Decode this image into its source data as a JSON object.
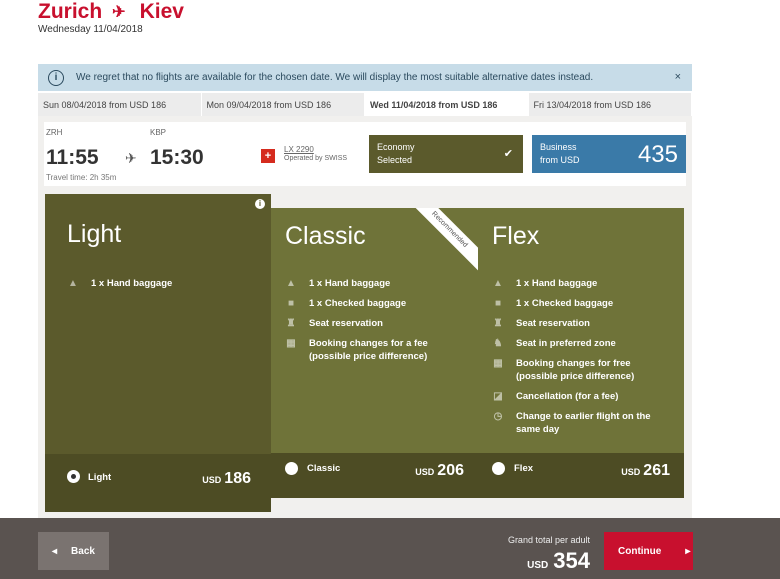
{
  "header": {
    "origin": "Zurich",
    "destination": "Kiev",
    "date": "Wednesday 11/04/2018"
  },
  "notice": {
    "text": "We regret that no flights are available for the chosen date. We will display the most suitable alternative dates instead.",
    "close": "×"
  },
  "dates": [
    {
      "label": "Sun 08/04/2018 from USD 186"
    },
    {
      "label": "Mon 09/04/2018 from USD 186"
    },
    {
      "label": "Wed 11/04/2018 from USD 186"
    },
    {
      "label": "Fri 13/04/2018 from USD 186"
    }
  ],
  "flight": {
    "dep_code": "ZRH",
    "dep_time": "11:55",
    "arr_code": "KBP",
    "arr_time": "15:30",
    "travel_time": "Travel time: 2h 35m",
    "flight_no": "LX 2290",
    "operated_by": "Operated by SWISS",
    "economy": {
      "label": "Economy",
      "status": "Selected"
    },
    "business": {
      "label": "Business",
      "sub": "from USD",
      "price": "435"
    }
  },
  "fares": {
    "light": {
      "name": "Light",
      "features": [
        "1 x Hand baggage"
      ],
      "radio_label": "Light",
      "currency": "USD",
      "price": "186"
    },
    "classic": {
      "name": "Classic",
      "ribbon": "Recommended",
      "features": [
        "1 x Hand baggage",
        "1 x Checked baggage",
        "Seat reservation",
        "Booking changes for a fee (possible price difference)"
      ],
      "radio_label": "Classic",
      "currency": "USD",
      "price": "206"
    },
    "flex": {
      "name": "Flex",
      "features": [
        "1 x Hand baggage",
        "1 x Checked baggage",
        "Seat reservation",
        "Seat in preferred zone",
        "Booking changes for free (possible price difference)",
        "Cancellation (for a fee)",
        "Change to earlier flight on the same day"
      ],
      "radio_label": "Flex",
      "currency": "USD",
      "price": "261"
    }
  },
  "footer": {
    "back": "Back",
    "grand_label": "Grand total per adult",
    "currency": "USD",
    "total": "354",
    "continue": "Continue"
  }
}
